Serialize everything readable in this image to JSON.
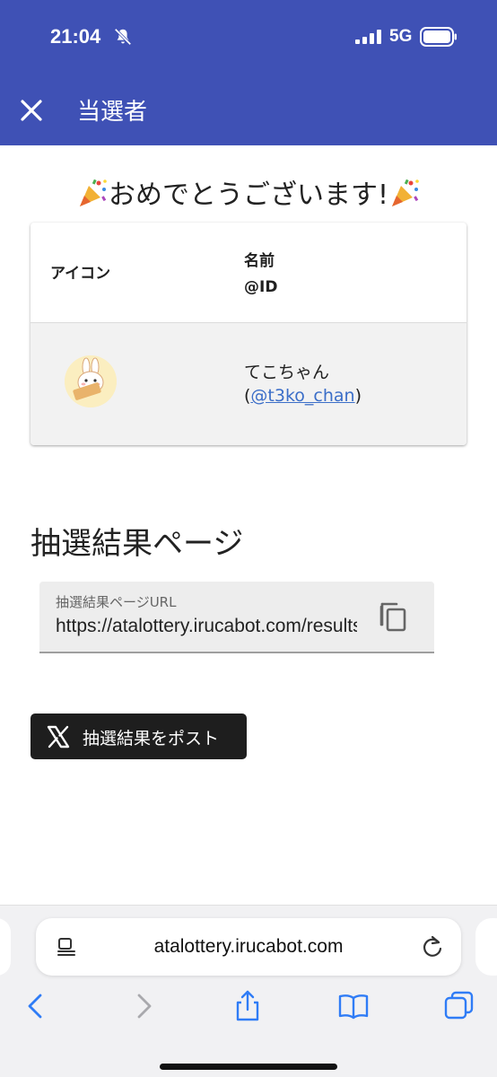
{
  "status_bar": {
    "time": "21:04",
    "network": "5G"
  },
  "header": {
    "title": "当選者"
  },
  "congrats": {
    "text": "おめでとうございます!"
  },
  "winners_table": {
    "col_icon": "アイコン",
    "col_name": "名前",
    "col_id": "@ID",
    "rows": [
      {
        "name": "てこちゃん",
        "id_open": "(",
        "id": "@t3ko_chan",
        "id_close": ")"
      }
    ]
  },
  "results_section": {
    "title": "抽選結果ページ",
    "url_label": "抽選結果ページURL",
    "url_value": "https://atalottery.irucabot.com/results"
  },
  "post_button": {
    "label": "抽選結果をポスト"
  },
  "browser": {
    "address": "atalottery.irucabot.com"
  },
  "colors": {
    "app_bar": "#3f51b5",
    "link": "#3b6ec8",
    "post_button": "#1e1e1e"
  }
}
